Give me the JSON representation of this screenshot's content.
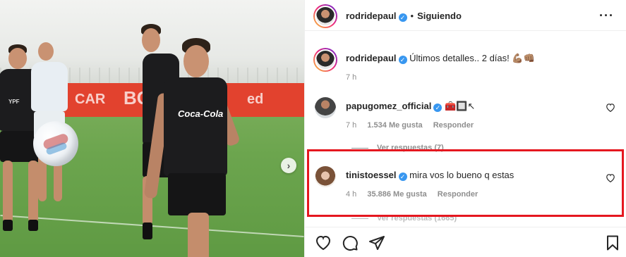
{
  "post_author": {
    "username": "rodridepaul",
    "follow_state": "Siguiendo"
  },
  "caption": {
    "username": "rodridepaul",
    "text": "Últimos detalles.. 2 días! 💪🏽👊🏽",
    "time": "7 h"
  },
  "comments": [
    {
      "username": "papugomez_official",
      "text": "🧰🔲↖",
      "time": "7 h",
      "likes": "1.534 Me gusta",
      "reply": "Responder",
      "view_replies": "Ver respuestas (7)"
    },
    {
      "username": "tinistoessel",
      "text": "mira vos lo bueno q estas",
      "time": "4 h",
      "likes": "35.886 Me gusta",
      "reply": "Responder",
      "view_replies": "Ver respuestas (1665)"
    }
  ],
  "photo": {
    "ad_text": [
      "CAR",
      "BC",
      "ed"
    ],
    "shirt_text": [
      "Coca-Cola",
      "YPF"
    ]
  },
  "icons": {
    "more": "more-options-icon",
    "verified": "verified-badge-icon",
    "like": "heart-icon",
    "comment": "comment-icon",
    "share": "share-icon",
    "save": "bookmark-icon",
    "next": "chevron-right-icon"
  },
  "colors": {
    "verified": "#3897f0",
    "highlight_border": "#e5171f",
    "meta_text": "#8e8e8e"
  }
}
